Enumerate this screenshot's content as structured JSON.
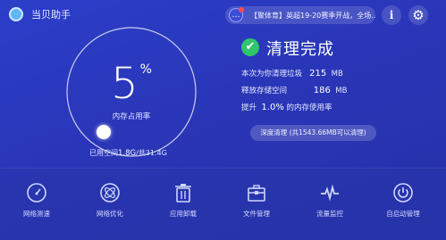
{
  "header": {
    "app_title": "当贝助手",
    "notice_text": "【聚体育】英超19-20赛季开战，全场…",
    "notice_icon": "notification-chat-icon",
    "info_icon": "info-icon",
    "settings_icon": "gear-icon"
  },
  "memory": {
    "value": "5",
    "unit": "%",
    "label": "内存占用率",
    "level": 0.05,
    "space_prefix": "已用空间",
    "space_used": "1.8G",
    "space_suffix": "/共31.4G"
  },
  "result": {
    "title": "清理完成",
    "stats": [
      {
        "label": "本次为你清理垃圾",
        "value": "215",
        "unit": "MB"
      },
      {
        "label": "释放存储空间",
        "value": "186",
        "unit": "MB"
      },
      {
        "label": "提升",
        "value": "1.0%",
        "unit": "的内存使用率"
      }
    ],
    "deep_clean_label": "深度清理 (共1543.66MB可以清理)"
  },
  "tools": [
    {
      "label": "网络测速",
      "icon": "speedometer-icon"
    },
    {
      "label": "网络优化",
      "icon": "network-optimize-icon"
    },
    {
      "label": "应用卸载",
      "icon": "trash-icon"
    },
    {
      "label": "文件管理",
      "icon": "toolbox-icon"
    },
    {
      "label": "流量监控",
      "icon": "pulse-icon"
    },
    {
      "label": "自启动管理",
      "icon": "power-icon"
    }
  ],
  "colors": {
    "background": "#2a36b8",
    "success": "#2fc56a",
    "accent_red": "#ff4d4d"
  }
}
